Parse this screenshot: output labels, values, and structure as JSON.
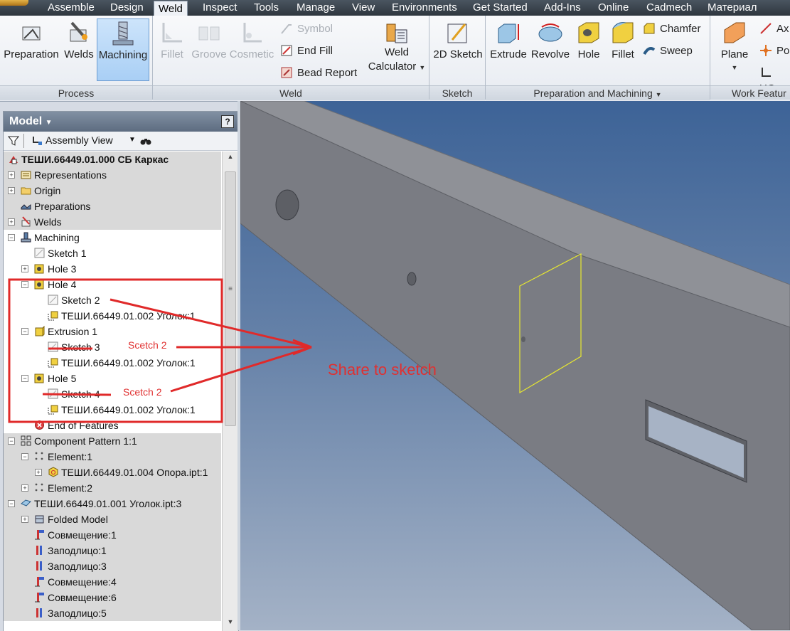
{
  "menu": {
    "tabs": [
      "Assemble",
      "Design",
      "Weld",
      "Inspect",
      "Tools",
      "Manage",
      "View",
      "Environments",
      "Get Started",
      "Add-Ins",
      "Online",
      "Cadmech",
      "Материал"
    ],
    "active": "Weld"
  },
  "ribbon": {
    "process": {
      "title": "Process",
      "preparation": "Preparation",
      "welds": "Welds",
      "machining": "Machining"
    },
    "weld": {
      "title": "Weld",
      "fillet": "Fillet",
      "groove": "Groove",
      "cosmetic": "Cosmetic",
      "symbol": "Symbol",
      "end_fill": "End Fill",
      "bead_report": "Bead Report",
      "weld_calc_line1": "Weld",
      "weld_calc_line2": "Calculator"
    },
    "sketch": {
      "title": "Sketch",
      "sketch_2d": "2D Sketch"
    },
    "prep_mach": {
      "title": "Preparation and Machining",
      "extrude": "Extrude",
      "revolve": "Revolve",
      "hole": "Hole",
      "fillet": "Fillet",
      "chamfer": "Chamfer",
      "sweep": "Sweep"
    },
    "work": {
      "title": "Work Featur",
      "plane": "Plane",
      "axis": "Ax",
      "point": "Po",
      "ucs": "UC"
    }
  },
  "browser": {
    "title": "Model",
    "view_selector": "Assembly View",
    "help": "?",
    "tree": [
      {
        "label": "ТЕШИ.66449.01.000 СБ Каркас"
      },
      {
        "label": "Representations"
      },
      {
        "label": "Origin"
      },
      {
        "label": "Preparations"
      },
      {
        "label": "Welds"
      },
      {
        "label": "Machining"
      },
      {
        "label": "Sketch 1"
      },
      {
        "label": "Hole 3"
      },
      {
        "label": "Hole 4"
      },
      {
        "label": "Sketch 2"
      },
      {
        "label": "ТЕШИ.66449.01.002 Уголок:1"
      },
      {
        "label": "Extrusion 1"
      },
      {
        "label": "Sketch 3"
      },
      {
        "label": "ТЕШИ.66449.01.002 Уголок:1"
      },
      {
        "label": "Hole 5"
      },
      {
        "label": "Sketch 4"
      },
      {
        "label": "ТЕШИ.66449.01.002 Уголок:1"
      },
      {
        "label": "End of Features"
      },
      {
        "label": "Component Pattern 1:1"
      },
      {
        "label": "Element:1"
      },
      {
        "label": "ТЕШИ.66449.01.004 Опора.ipt:1"
      },
      {
        "label": "Element:2"
      },
      {
        "label": "ТЕШИ.66449.01.001 Уголок.ipt:3"
      },
      {
        "label": "Folded Model"
      },
      {
        "label": "Совмещение:1"
      },
      {
        "label": "Заподлицо:1"
      },
      {
        "label": "Заподлицо:3"
      },
      {
        "label": "Совмещение:4"
      },
      {
        "label": "Совмещение:6"
      },
      {
        "label": "Заподлицо:5"
      }
    ]
  },
  "annotations": {
    "label_1": "Scetch 2",
    "label_2": "Scetch 2",
    "share": "Share to sketch"
  },
  "colors": {
    "annotation": "#e03030",
    "sketch_outline": "#e8e830",
    "beam": "#7d7f86"
  }
}
